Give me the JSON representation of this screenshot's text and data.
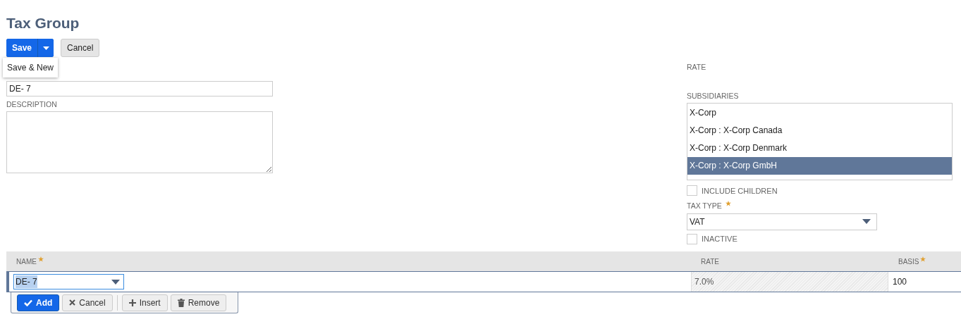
{
  "title": "Tax Group",
  "actions": {
    "save": "Save",
    "cancel": "Cancel",
    "menu": {
      "open": true,
      "items": [
        "Save & New"
      ]
    }
  },
  "left": {
    "name_value": "DE- 7",
    "description_label": "DESCRIPTION"
  },
  "right": {
    "rate_label": "RATE",
    "subsidiaries_label": "SUBSIDIARIES",
    "subsidiaries": [
      {
        "label": "X-Corp",
        "selected": false
      },
      {
        "label": "X-Corp : X-Corp Canada",
        "selected": false
      },
      {
        "label": "X-Corp : X-Corp Denmark",
        "selected": false
      },
      {
        "label": "X-Corp : X-Corp GmbH",
        "selected": true
      }
    ],
    "include_children": {
      "label": "INCLUDE CHILDREN",
      "checked": false
    },
    "tax_type": {
      "label": "TAX TYPE",
      "required": true,
      "value": "VAT"
    },
    "inactive": {
      "label": "INACTIVE",
      "checked": false
    }
  },
  "table": {
    "columns": [
      {
        "label": "NAME",
        "required": true
      },
      {
        "label": "RATE",
        "required": false
      },
      {
        "label": "BASIS",
        "required": true
      }
    ],
    "row": {
      "name": "DE- 7",
      "rate": "7.0%",
      "basis": "100"
    },
    "buttons": [
      {
        "kind": "add",
        "label": "Add"
      },
      {
        "kind": "cancel",
        "label": "Cancel"
      },
      {
        "kind": "insert",
        "label": "Insert"
      },
      {
        "kind": "remove",
        "label": "Remove"
      }
    ]
  }
}
